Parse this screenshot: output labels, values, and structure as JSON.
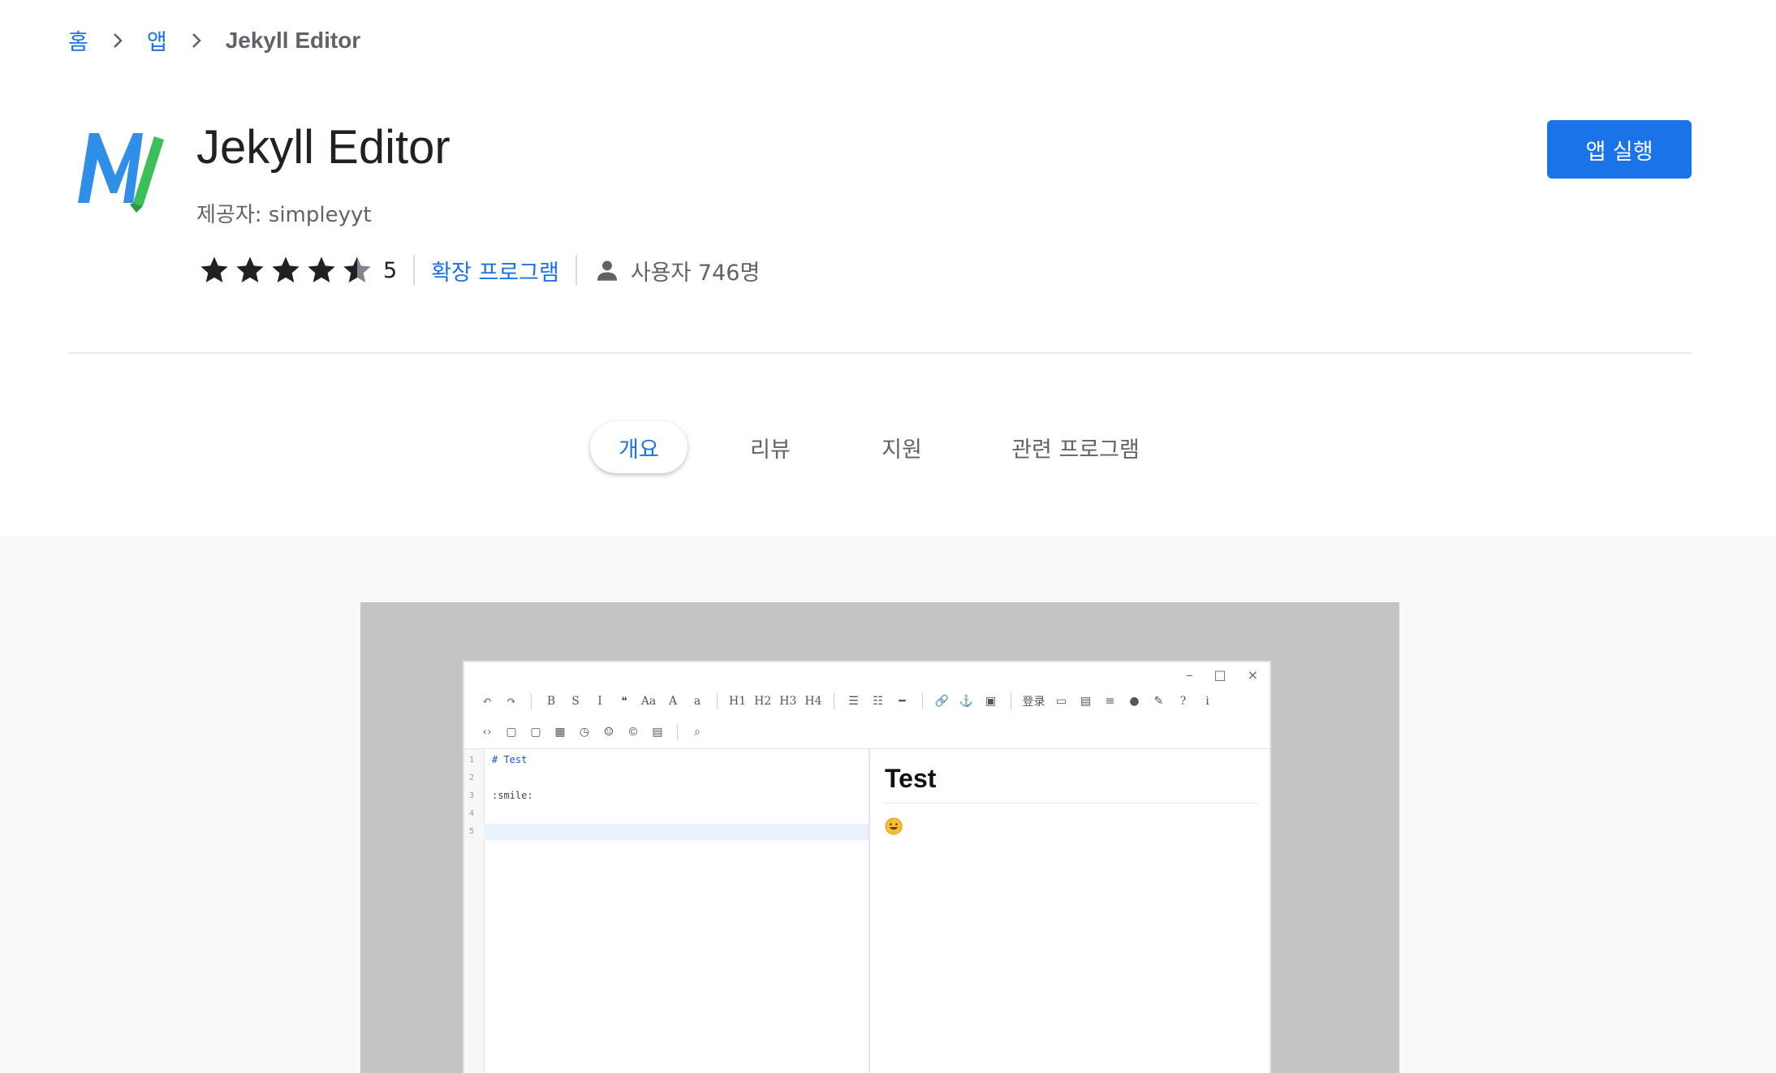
{
  "breadcrumb": {
    "home": "홈",
    "apps": "앱",
    "current": "Jekyll Editor"
  },
  "app": {
    "title": "Jekyll Editor",
    "provider": "제공자: simpleyyt",
    "rating_value": 4.5,
    "rating_count": "5",
    "category": "확장 프로그램",
    "users": "사용자 746명",
    "launch_label": "앱 실행"
  },
  "tabs": [
    {
      "label": "개요",
      "active": true
    },
    {
      "label": "리뷰",
      "active": false
    },
    {
      "label": "지원",
      "active": false
    },
    {
      "label": "관련 프로그램",
      "active": false
    }
  ],
  "colors": {
    "accent": "#1a73e8",
    "star": "#202124",
    "logo_blue": "#2f8ee8",
    "logo_green": "#3bbf5a"
  },
  "screenshot": {
    "toolbar_row1": [
      "↶",
      "↷",
      "|",
      "B",
      "S",
      "I",
      "❝",
      "Aa",
      "A",
      "a",
      "|",
      "H1",
      "H2",
      "H3",
      "H4",
      "|",
      "☰",
      "☷",
      "━",
      "|",
      "🔗",
      "⚓",
      "▣",
      "|",
      "登录",
      "▭",
      "▤",
      "≡",
      "●",
      "✎",
      "?",
      "i"
    ],
    "toolbar_row2": [
      "‹›",
      "▢",
      "▢",
      "▦",
      "◷",
      "☺",
      "©",
      "▤",
      "|",
      "⌕"
    ],
    "window_controls": [
      "–",
      "□",
      "×"
    ],
    "code_lines": [
      {
        "no": "1",
        "text": "# Test"
      },
      {
        "no": "2",
        "text": ""
      },
      {
        "no": "3",
        "text": ":smile:"
      },
      {
        "no": "4",
        "text": ""
      },
      {
        "no": "5",
        "text": ""
      }
    ],
    "preview_title": "Test"
  }
}
